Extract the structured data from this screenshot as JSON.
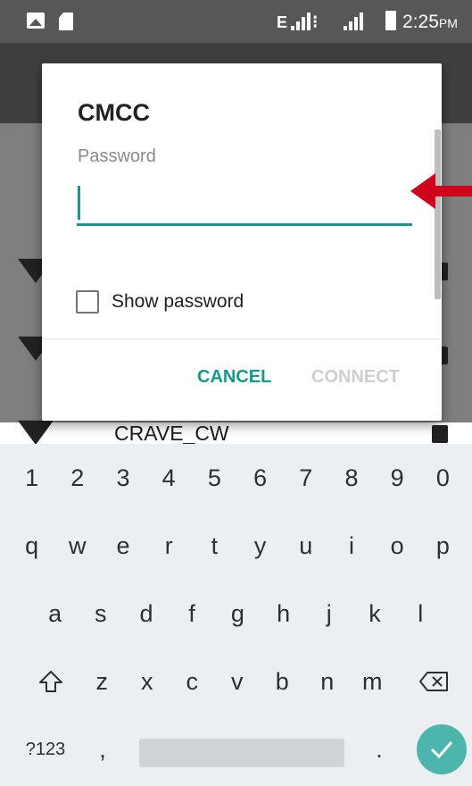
{
  "status_bar": {
    "network_type": "E",
    "time": "2:25",
    "ampm": "PM",
    "icons": [
      "image-icon",
      "sd-card-icon",
      "signal-icon",
      "data-activity-icon",
      "signal-icon",
      "battery-icon"
    ]
  },
  "background": {
    "visible_network_name": "CRAVE_CW"
  },
  "dialog": {
    "title": "CMCC",
    "password_label": "Password",
    "password_value": "",
    "show_password_label": "Show password",
    "show_password_checked": false,
    "cancel_label": "CANCEL",
    "connect_label": "CONNECT",
    "accent_color": "#14998a"
  },
  "keyboard": {
    "row_numbers": [
      "1",
      "2",
      "3",
      "4",
      "5",
      "6",
      "7",
      "8",
      "9",
      "0"
    ],
    "row_top": [
      "q",
      "w",
      "e",
      "r",
      "t",
      "y",
      "u",
      "i",
      "o",
      "p"
    ],
    "row_middle": [
      "a",
      "s",
      "d",
      "f",
      "g",
      "h",
      "j",
      "k",
      "l"
    ],
    "row_bottom": [
      "z",
      "x",
      "c",
      "v",
      "b",
      "n",
      "m"
    ],
    "symbols_key": "?123",
    "comma_key": ",",
    "period_key": ".",
    "icons": [
      "shift-icon",
      "backspace-icon",
      "enter-check-icon"
    ]
  },
  "annotation": {
    "arrow_color": "#d0021b"
  }
}
